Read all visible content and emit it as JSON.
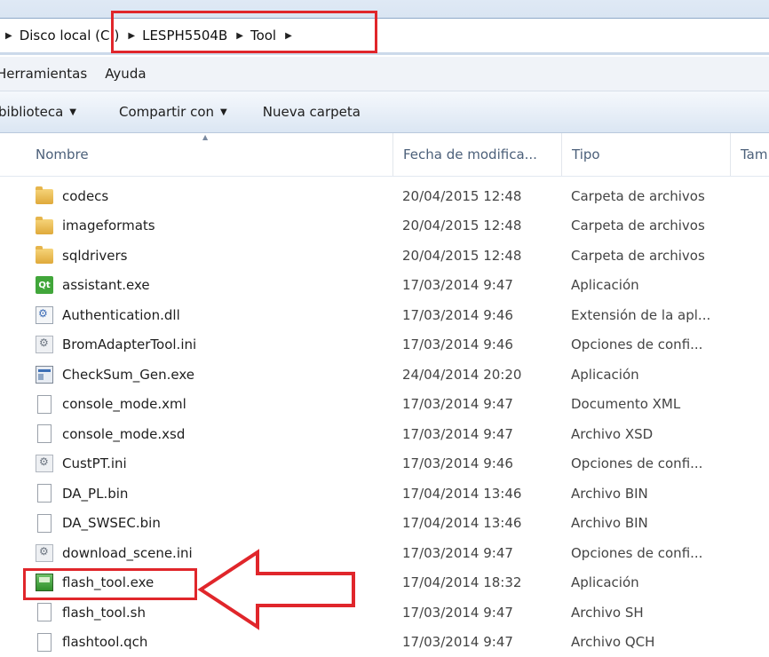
{
  "address": {
    "crumbs": [
      "Disco local (C:)",
      "LESPH5504B",
      "Tool"
    ]
  },
  "menu": [
    "Herramientas",
    "Ayuda"
  ],
  "toolbar": {
    "library_label": "biblioteca",
    "share_label": "Compartir con",
    "new_folder_label": "Nueva carpeta"
  },
  "columns": {
    "name": "Nombre",
    "date": "Fecha de modifica...",
    "type": "Tipo",
    "size": "Tam"
  },
  "files": [
    {
      "name": "codecs",
      "date": "20/04/2015 12:48",
      "type": "Carpeta de archivos",
      "icon": "folder-icon"
    },
    {
      "name": "imageformats",
      "date": "20/04/2015 12:48",
      "type": "Carpeta de archivos",
      "icon": "folder-icon"
    },
    {
      "name": "sqldrivers",
      "date": "20/04/2015 12:48",
      "type": "Carpeta de archivos",
      "icon": "folder-icon"
    },
    {
      "name": "assistant.exe",
      "date": "17/03/2014 9:47",
      "type": "Aplicación",
      "icon": "qt-app-icon"
    },
    {
      "name": "Authentication.dll",
      "date": "17/03/2014 9:46",
      "type": "Extensión de la apl...",
      "icon": "dll-icon"
    },
    {
      "name": "BromAdapterTool.ini",
      "date": "17/03/2014 9:46",
      "type": "Opciones de confi...",
      "icon": "ini-icon"
    },
    {
      "name": "CheckSum_Gen.exe",
      "date": "24/04/2014 20:20",
      "type": "Aplicación",
      "icon": "exe-icon"
    },
    {
      "name": "console_mode.xml",
      "date": "17/03/2014 9:47",
      "type": "Documento XML",
      "icon": "file-icon"
    },
    {
      "name": "console_mode.xsd",
      "date": "17/03/2014 9:47",
      "type": "Archivo XSD",
      "icon": "file-icon"
    },
    {
      "name": "CustPT.ini",
      "date": "17/03/2014 9:46",
      "type": "Opciones de confi...",
      "icon": "ini-icon"
    },
    {
      "name": "DA_PL.bin",
      "date": "17/04/2014 13:46",
      "type": "Archivo BIN",
      "icon": "file-icon"
    },
    {
      "name": "DA_SWSEC.bin",
      "date": "17/04/2014 13:46",
      "type": "Archivo BIN",
      "icon": "file-icon"
    },
    {
      "name": "download_scene.ini",
      "date": "17/03/2014 9:47",
      "type": "Opciones de confi...",
      "icon": "ini-icon"
    },
    {
      "name": "flash_tool.exe",
      "date": "17/04/2014 18:32",
      "type": "Aplicación",
      "icon": "flash-tool-icon"
    },
    {
      "name": "flash_tool.sh",
      "date": "17/03/2014 9:47",
      "type": "Archivo SH",
      "icon": "file-icon"
    },
    {
      "name": "flashtool.qch",
      "date": "17/03/2014 9:47",
      "type": "Archivo QCH",
      "icon": "file-icon"
    }
  ],
  "annotation_color": "#e0262b"
}
